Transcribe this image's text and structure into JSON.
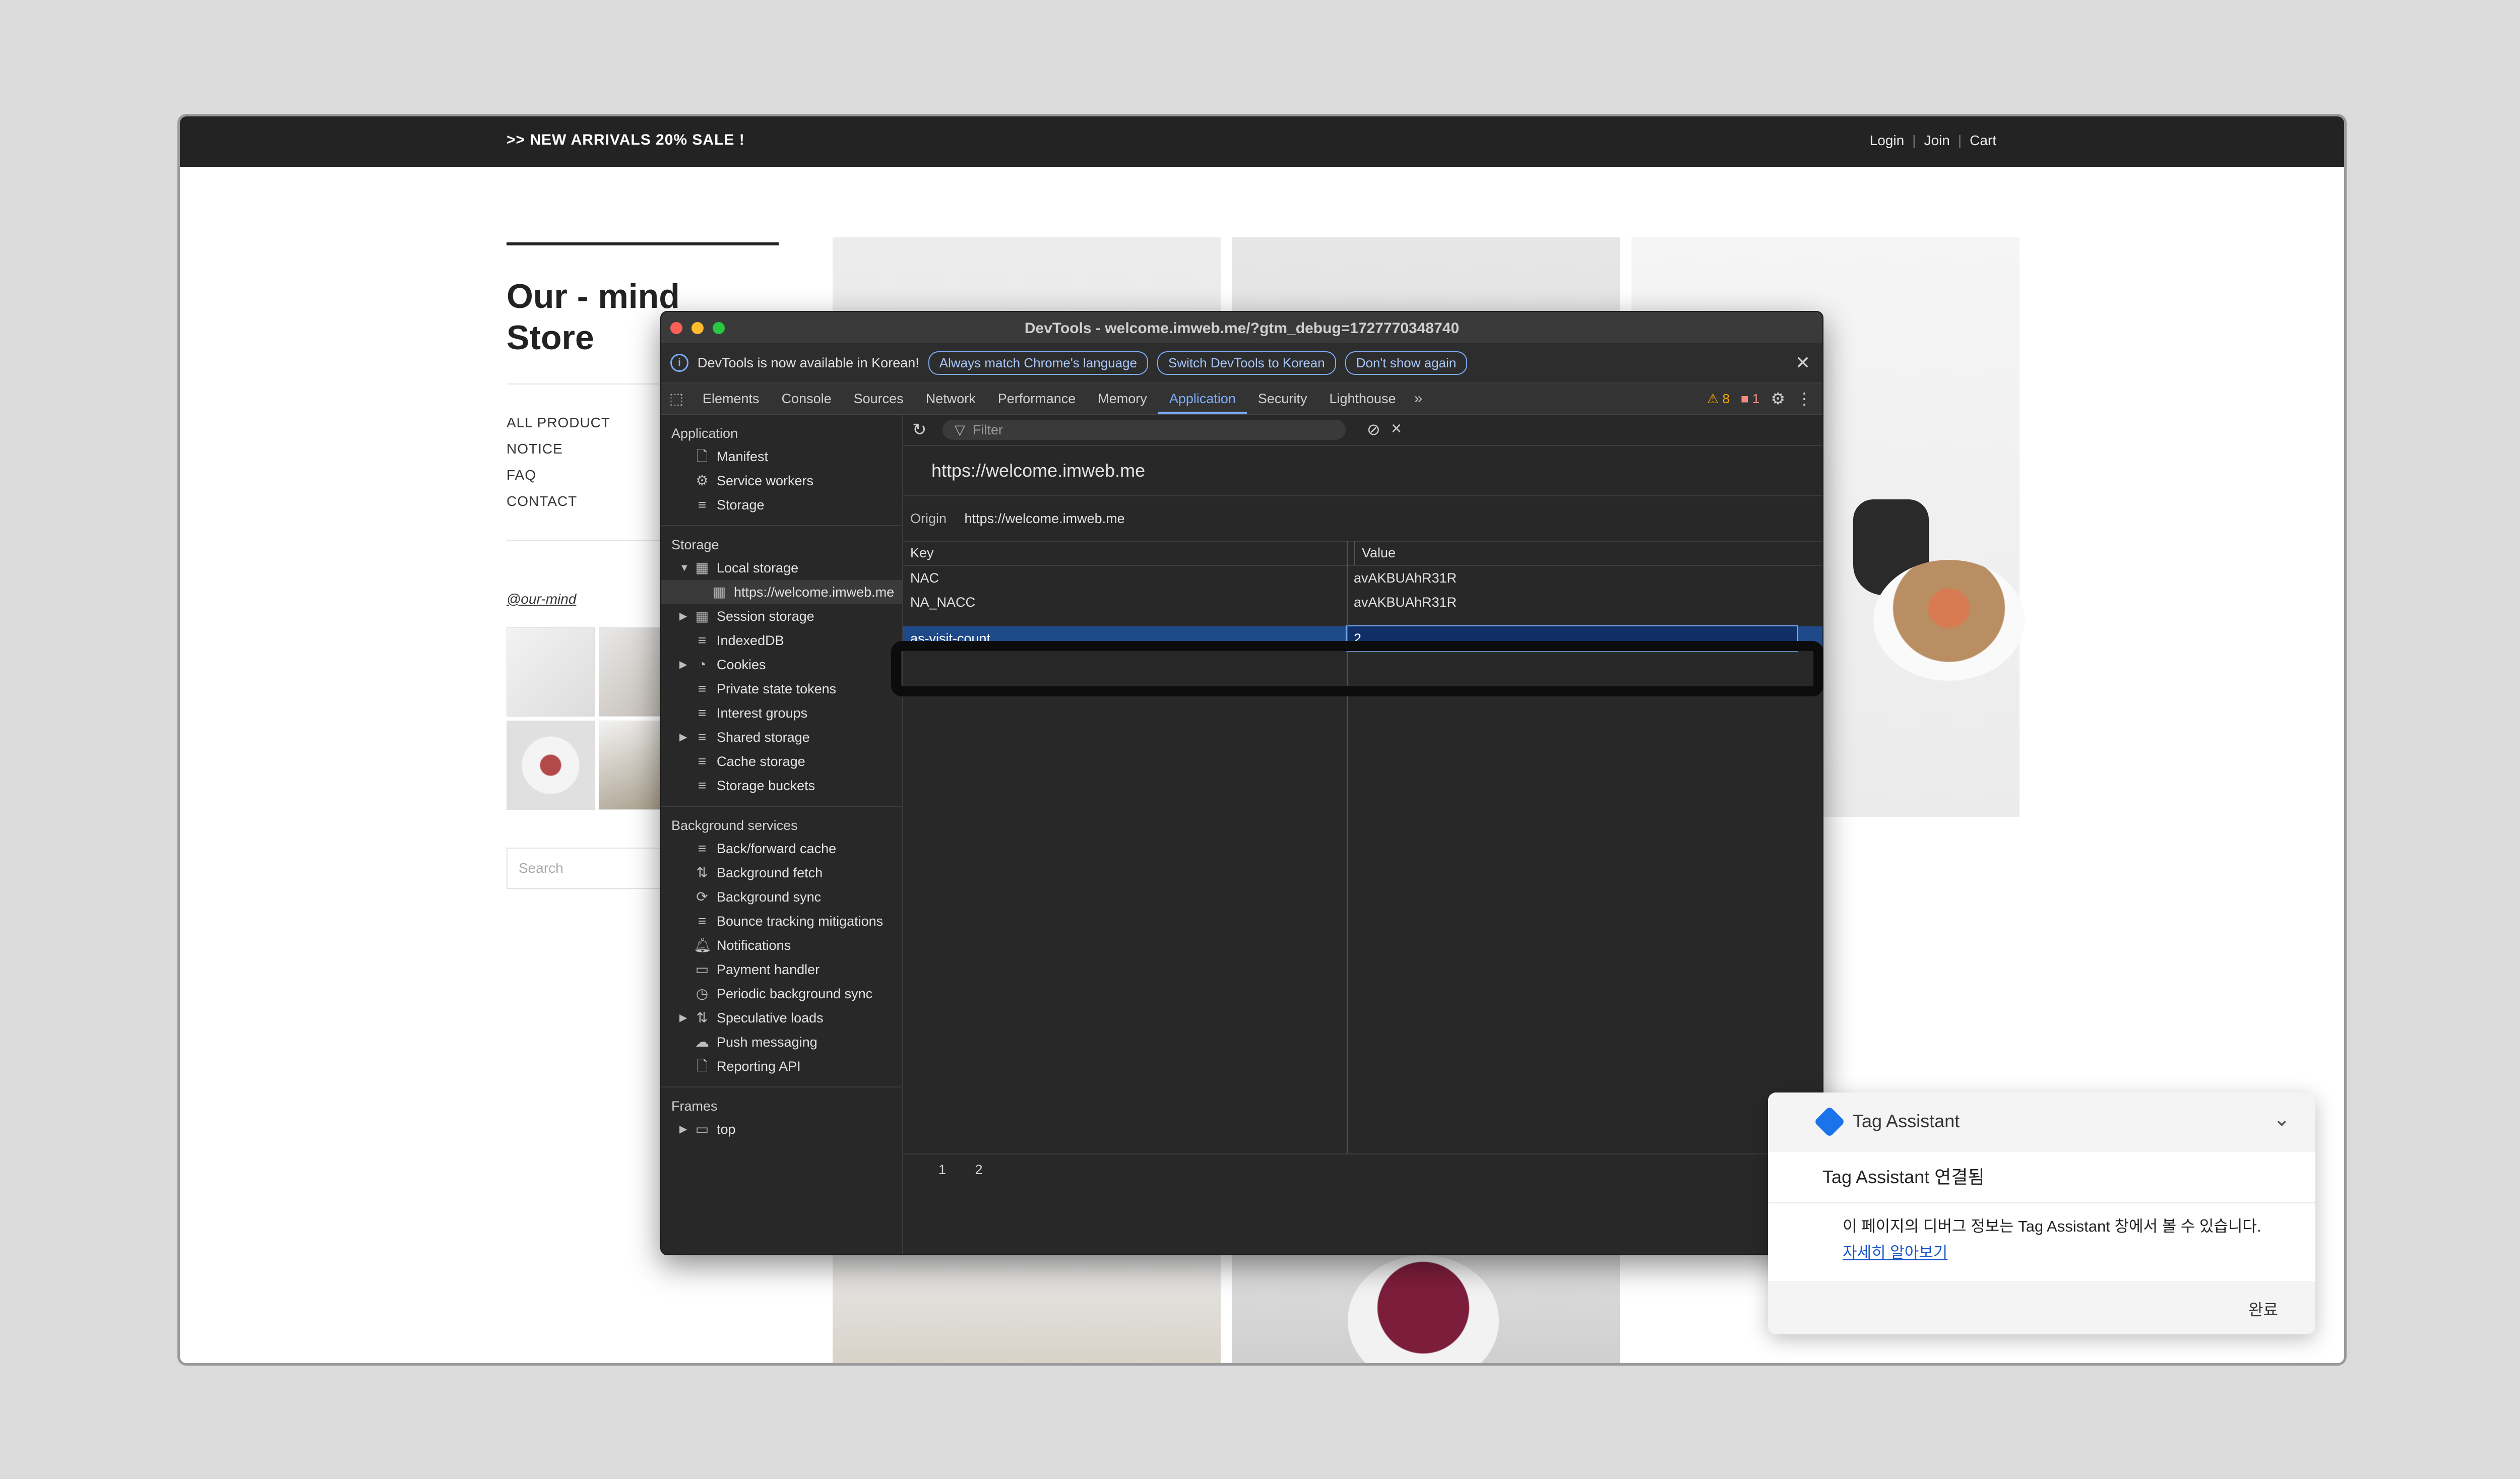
{
  "site": {
    "promo": ">> NEW ARRIVALS 20% SALE !",
    "login": "Login",
    "join": "Join",
    "cart": "Cart",
    "sep": "|",
    "brand": "Our - mind Store",
    "menu": [
      "ALL PRODUCT",
      "NOTICE",
      "FAQ",
      "CONTACT"
    ],
    "instagram": "@our-mind",
    "search_placeholder": "Search"
  },
  "devtools": {
    "title": "DevTools - welcome.imweb.me/?gtm_debug=1727770348740",
    "info_text": "DevTools is now available in Korean!",
    "info_buttons": [
      "Always match Chrome's language",
      "Switch DevTools to Korean",
      "Don't show again"
    ],
    "tabs": [
      "Elements",
      "Console",
      "Sources",
      "Network",
      "Performance",
      "Memory",
      "Application",
      "Security",
      "Lighthouse"
    ],
    "active_tab": "Application",
    "warnings": "8",
    "errors": "1",
    "sidebar": {
      "application_head": "Application",
      "application_items": [
        "Manifest",
        "Service workers",
        "Storage"
      ],
      "storage_head": "Storage",
      "local_storage": "Local storage",
      "local_storage_origin": "https://welcome.imweb.me",
      "storage_items": [
        "Session storage",
        "IndexedDB",
        "Cookies",
        "Private state tokens",
        "Interest groups",
        "Shared storage",
        "Cache storage",
        "Storage buckets"
      ],
      "background_head": "Background services",
      "background_items": [
        "Back/forward cache",
        "Background fetch",
        "Background sync",
        "Bounce tracking mitigations",
        "Notifications",
        "Payment handler",
        "Periodic background sync",
        "Speculative loads",
        "Push messaging",
        "Reporting API"
      ],
      "frames_head": "Frames",
      "frames_top": "top"
    },
    "filter_placeholder": "Filter",
    "origin_title": "https://welcome.imweb.me",
    "origin_label": "Origin",
    "origin_value": "https://welcome.imweb.me",
    "columns": {
      "key": "Key",
      "value": "Value"
    },
    "rows": [
      {
        "key": "NAC",
        "value": "avAKBUAhR31R"
      },
      {
        "key": "NA_NACC",
        "value": "avAKBUAhR31R"
      }
    ],
    "selected_row": {
      "key": "as-visit-count",
      "value": "2"
    },
    "pages": [
      "1",
      "2"
    ]
  },
  "tag_assistant": {
    "title": "Tag Assistant",
    "status": "Tag Assistant 연결됨",
    "message": "이 페이지의 디버그 정보는 Tag Assistant 창에서 볼 수 있습니다.",
    "link": "자세히 알아보기",
    "done": "완료"
  }
}
